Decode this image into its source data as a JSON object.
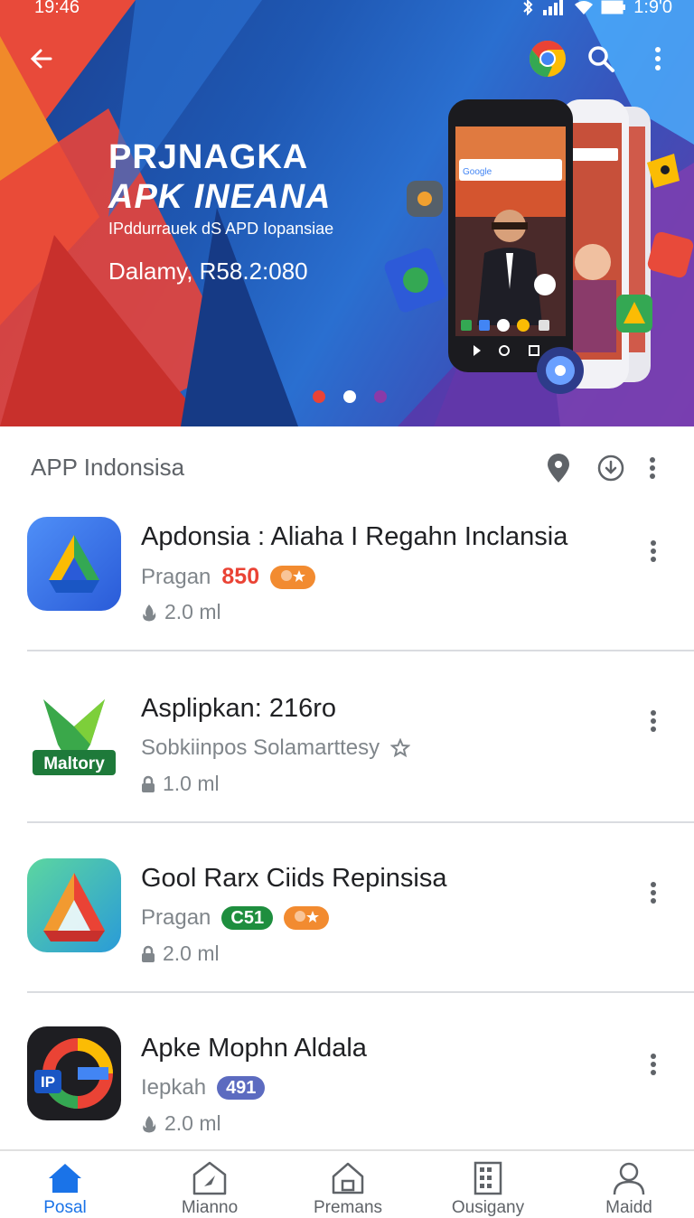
{
  "status_bar": {
    "time_left": "19:46",
    "time_right": "1:9'0"
  },
  "hero": {
    "title_line1": "PRJNAGKA",
    "title_line2": "APK INEANA",
    "subtitle": "IPddurrauek dS APD Iopansiae",
    "date_line": "Dalamy, R58.2:080",
    "phone_search_label": "Google",
    "carousel_pages": 3,
    "carousel_active": 1
  },
  "section": {
    "title": "APP Indonsisa"
  },
  "apps": [
    {
      "name": "Apdonsia : Aliaha I Regahn Inclansia",
      "developer": "Pragan",
      "price": "850",
      "badge": "",
      "size": "2.0 ml",
      "size_icon": "flame-icon"
    },
    {
      "name": "Asplipkan: 216ro",
      "developer": "Sobkiinpos Solamarttesy",
      "price": "",
      "badge": "",
      "size": "1.0 ml",
      "size_icon": "lock-icon",
      "icon_text": "Maltory"
    },
    {
      "name": "Gool Rarx Ciids Repinsisa",
      "developer": "Pragan",
      "price": "",
      "badge": "C51",
      "size": "2.0 ml",
      "size_icon": "lock-icon"
    },
    {
      "name": "Apke Mophn Aldala",
      "developer": "Iepkah",
      "price": "",
      "badge": "491",
      "size": "2.0 ml",
      "size_icon": "flame-icon",
      "icon_text": "IP"
    }
  ],
  "bottom_nav": [
    {
      "label": "Posal",
      "icon": "home-icon",
      "active": true
    },
    {
      "label": "Mianno",
      "icon": "compass-house-icon",
      "active": false
    },
    {
      "label": "Premans",
      "icon": "house-outline-icon",
      "active": false
    },
    {
      "label": "Ousigany",
      "icon": "building-icon",
      "active": false
    },
    {
      "label": "Maidd",
      "icon": "person-icon",
      "active": false
    }
  ],
  "colors": {
    "accent": "#1a73e8",
    "price_red": "#ea4335",
    "badge_orange": "#f28b30",
    "badge_green": "#1e8e3e",
    "badge_blue": "#5c6bc0"
  }
}
